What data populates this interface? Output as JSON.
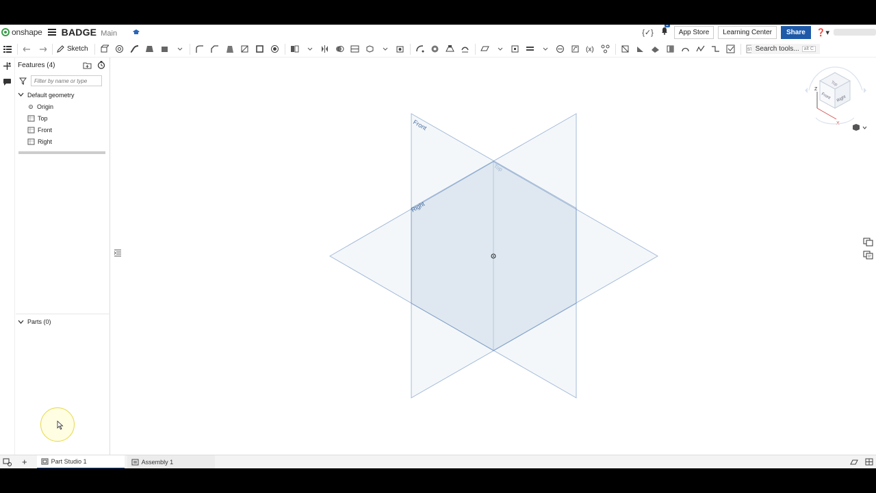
{
  "app": {
    "logo_text": "onshape",
    "document_title": "BADGE",
    "branch": "Main"
  },
  "top_right": {
    "notification_count": "1",
    "app_store_label": "App Store",
    "learning_center_label": "Learning Center",
    "share_label": "Share",
    "help_icon": "help-icon"
  },
  "toolbar": {
    "sketch_label": "Sketch",
    "search_label": "Search tools...",
    "search_shortcut": "alt C"
  },
  "features": {
    "header": "Features (4)",
    "filter_placeholder": "Filter by name or type",
    "group_label": "Default geometry",
    "items": [
      {
        "label": "Origin"
      },
      {
        "label": "Top"
      },
      {
        "label": "Front"
      },
      {
        "label": "Right"
      }
    ]
  },
  "parts": {
    "header": "Parts (0)"
  },
  "viewport": {
    "plane_labels": {
      "front": "Front",
      "top": "Top",
      "right": "Right"
    },
    "view_cube": {
      "top": "Top",
      "front": "Front",
      "right": "Right",
      "axis_z": "Z",
      "axis_x": "X"
    },
    "plane_color": "#6a8fbf"
  },
  "tabs": {
    "items": [
      {
        "label": "Part Studio 1"
      },
      {
        "label": "Assembly 1"
      }
    ]
  }
}
